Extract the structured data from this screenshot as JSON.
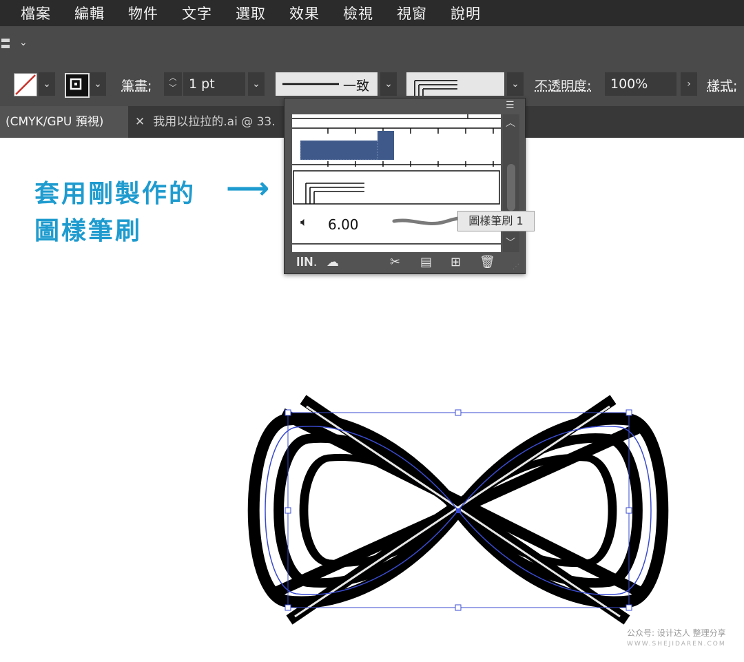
{
  "menu": [
    "檔案",
    "編輯",
    "物件",
    "文字",
    "選取",
    "效果",
    "檢視",
    "視窗",
    "說明"
  ],
  "control": {
    "stroke_label": "筆畫:",
    "stroke_weight": "1 pt",
    "profile_label": "一致",
    "opacity_label": "不透明度:",
    "opacity_value": "100%",
    "style_label": "樣式:"
  },
  "tabs": {
    "active": "(CMYK/GPU 預視)",
    "inactive": "我用以拉拉的.ai @ 33."
  },
  "annotation": {
    "line1": "套用剛製作的",
    "line2": "圖樣筆刷",
    "arrow": "⟶"
  },
  "brush_panel": {
    "brush_size": "6.00",
    "tooltip": "圖樣筆刷 1"
  },
  "watermark": {
    "line1": "公众号: 设计达人 整理分享",
    "line2": "WWW.SHEJIDAREN.COM"
  },
  "colors": {
    "accent": "#1e9bcf",
    "selection": "#3a4bd1",
    "stroke_swatch": "#c8332c"
  }
}
